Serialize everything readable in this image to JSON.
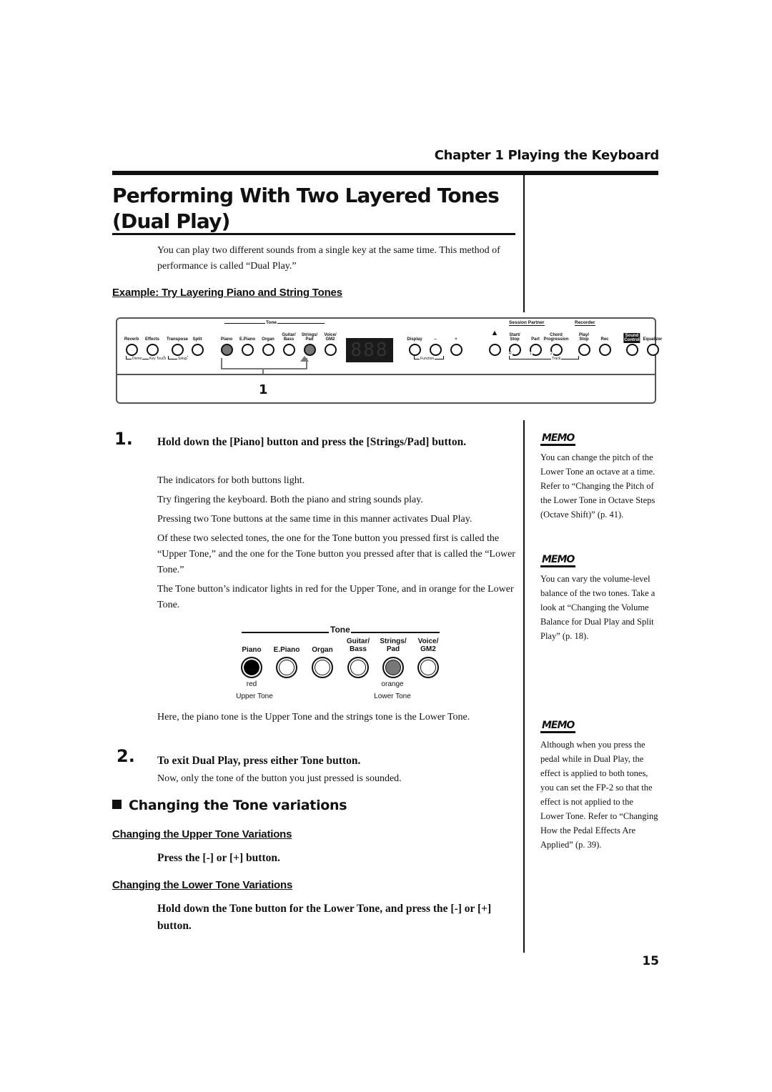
{
  "header": {
    "chapter": "Chapter 1 Playing the Keyboard"
  },
  "title": {
    "line1": "Performing With Two Layered Tones",
    "line2": "(Dual Play)"
  },
  "intro": "You can play two different sounds from a single key at the same time. This method of performance is called “Dual Play.”",
  "example_heading": "Example: Try Layering Piano and String Tones",
  "panel": {
    "tone_group": "Tone",
    "session_group": "Session Partner",
    "recorder_group": "Recorder",
    "display_digits": "888",
    "buttons": [
      {
        "label": "Reverb",
        "lit": false
      },
      {
        "label": "Effects",
        "lit": false
      },
      {
        "label": "Transpose",
        "lit": false
      },
      {
        "label": "Split",
        "lit": false
      },
      {
        "label": "Piano",
        "lit": true
      },
      {
        "label": "E.Piano",
        "lit": false
      },
      {
        "label": "Organ",
        "lit": false
      },
      {
        "label": "Guitar/\nBass",
        "lit": false
      },
      {
        "label": "Strings/\nPad",
        "lit": true
      },
      {
        "label": "Voice/\nGM2",
        "lit": false
      },
      {
        "label": "Display",
        "lit": false
      },
      {
        "label": "–",
        "lit": false
      },
      {
        "label": "+",
        "lit": false
      },
      {
        "label": "metronome",
        "lit": false
      },
      {
        "label": "Start/\nStop",
        "lit": false
      },
      {
        "label": "Part",
        "lit": false
      },
      {
        "label": "Chord\nProgression",
        "lit": false
      },
      {
        "label": "Play/\nStop",
        "lit": false
      },
      {
        "label": "Rec",
        "lit": false
      },
      {
        "label": "Sound\nControl",
        "lit": false
      },
      {
        "label": "Equalizer",
        "lit": false
      }
    ],
    "sub_labels": {
      "demo": "Demo",
      "key_touch": "Key Touch",
      "setup": "Setup",
      "function": "Function",
      "track": "Track",
      "track_r": "R",
      "track_1": "1",
      "track_2": "2"
    },
    "callout": "1"
  },
  "step1": {
    "number": "1.",
    "heading": "Hold down the [Piano] button and press the [Strings/Pad] button.",
    "paragraphs": [
      "The indicators for both buttons light.",
      "Try fingering the keyboard. Both the piano and string sounds play.",
      "Pressing two Tone buttons at the same time in this manner activates Dual Play.",
      "Of these two selected tones, the one for the Tone button you pressed first is called the “Upper Tone,” and the one for the Tone button you pressed after that is called the “Lower Tone.”",
      "The Tone button’s indicator lights in red for the Upper Tone, and in orange for the Lower Tone."
    ]
  },
  "tone_figure": {
    "group": "Tone",
    "buttons": [
      {
        "label": "Piano",
        "state": "upper"
      },
      {
        "label": "E.Piano",
        "state": "off"
      },
      {
        "label": "Organ",
        "state": "off"
      },
      {
        "label": "Guitar/\nBass",
        "state": "off"
      },
      {
        "label": "Strings/\nPad",
        "state": "lower"
      },
      {
        "label": "Voice/\nGM2",
        "state": "off"
      }
    ],
    "upper_color": "red",
    "lower_color": "orange",
    "upper_caption": "Upper Tone",
    "lower_caption": "Lower Tone"
  },
  "after_figure": "Here, the piano tone is the Upper Tone and the strings tone is the Lower Tone.",
  "step2": {
    "number": "2.",
    "heading": "To exit Dual Play, press either Tone button.",
    "text": "Now, only the tone of the button you just pressed is sounded."
  },
  "section": {
    "heading": "Changing the Tone variations",
    "upper_heading": "Changing the Upper Tone Variations",
    "upper_instruction": "Press the [-] or [+] button.",
    "lower_heading": "Changing the Lower Tone Variations",
    "lower_instruction": "Hold down the Tone button for the Lower Tone, and press the [-] or [+] button."
  },
  "memos": [
    {
      "icon": "MEMO",
      "text": "You can change the pitch of the Lower Tone an octave at a time. Refer to “Changing the Pitch of the Lower Tone in Octave Steps (Octave Shift)” (p. 41)."
    },
    {
      "icon": "MEMO",
      "text": "You can vary the volume-level balance of the two tones. Take a look at “Changing the Volume Balance for Dual Play and Split Play” (p. 18)."
    },
    {
      "icon": "MEMO",
      "text": "Although when you press the pedal while in Dual Play, the effect is applied to both tones, you can set the FP-2 so that the effect is not applied to the Lower Tone. Refer to “Changing How the Pedal Effects Are Applied” (p. 39)."
    }
  ],
  "page_number": "15"
}
